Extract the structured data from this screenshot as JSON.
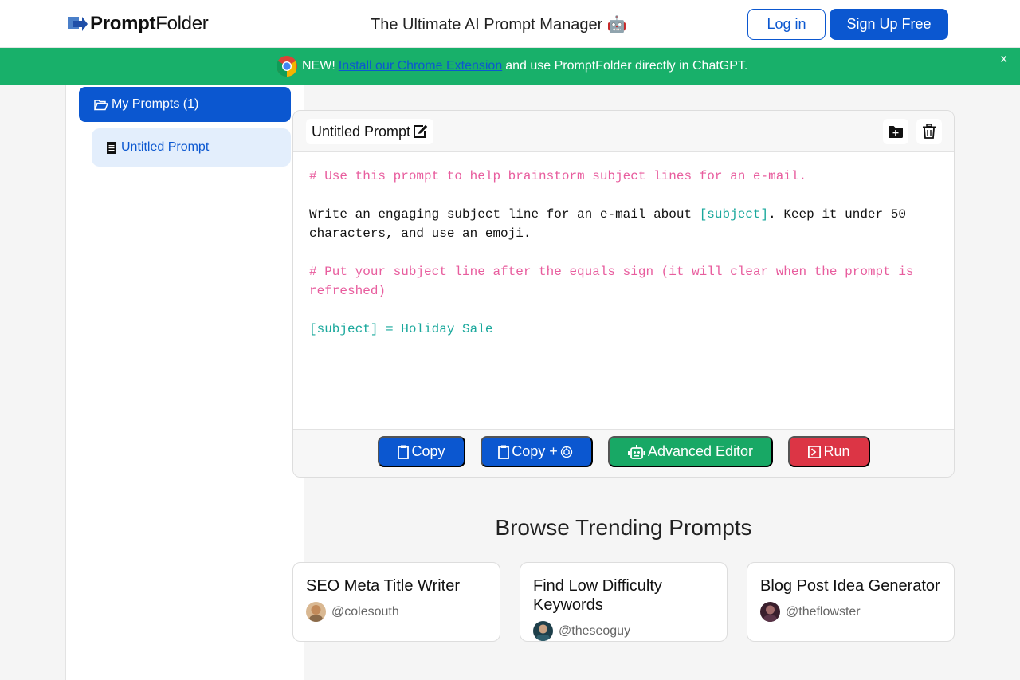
{
  "header": {
    "logo_bold": "Prompt",
    "logo_regular": "Folder",
    "tagline": "The Ultimate AI Prompt Manager 🤖",
    "login_label": "Log in",
    "signup_label": "Sign Up Free"
  },
  "banner": {
    "prefix": "NEW!",
    "link_text": "Install our Chrome Extension",
    "suffix": "and use PromptFolder directly in ChatGPT.",
    "close_label": "x",
    "background": "#18b06a"
  },
  "sidebar": {
    "folder_label": "My Prompts (1)",
    "items": [
      {
        "label": "Untitled Prompt"
      }
    ]
  },
  "editor": {
    "title": "Untitled Prompt",
    "lines": [
      {
        "type": "comment",
        "text": "# Use this prompt to help brainstorm subject lines for an e-mail."
      },
      {
        "type": "blank",
        "text": ""
      },
      {
        "type": "text",
        "before": "Write an engaging subject line for an e-mail about ",
        "var": "[subject]",
        "after": ". Keep it under 50 characters, and use an emoji."
      },
      {
        "type": "blank",
        "text": ""
      },
      {
        "type": "comment",
        "text": "# Put your subject line after the equals sign (it will clear when the prompt is refreshed)"
      },
      {
        "type": "blank",
        "text": ""
      },
      {
        "type": "var",
        "text": "[subject] = Holiday Sale"
      }
    ],
    "buttons": {
      "copy": "Copy",
      "copy_plus": "Copy +",
      "advanced": "Advanced Editor",
      "run": "Run"
    }
  },
  "trending": {
    "title": "Browse Trending Prompts",
    "cards": [
      {
        "title": "SEO Meta Title Writer",
        "user": "@colesouth",
        "avatar_color": "#c28a5a"
      },
      {
        "title": "Find Low Difficulty Keywords",
        "user": "@theseoguy",
        "avatar_color": "#2f5d6b"
      },
      {
        "title": "Blog Post Idea Generator",
        "user": "@theflowster",
        "avatar_color": "#5a3448"
      }
    ]
  },
  "colors": {
    "primary": "#0b57d0",
    "success": "#18a865",
    "danger": "#dc3545",
    "comment": "#e85d9e",
    "variable": "#1aa89c"
  }
}
